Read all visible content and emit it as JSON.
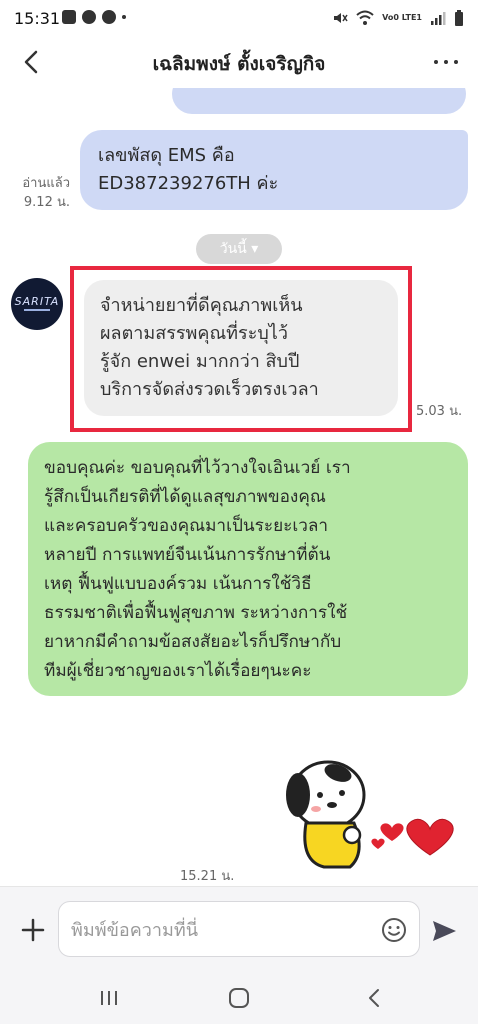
{
  "status_bar": {
    "time": "15:31",
    "network_label": "Vo0 LTE1",
    "icons": [
      "gallery-icon",
      "line-notification-icon",
      "line-notification-icon",
      "dot-icon",
      "mute-icon",
      "wifi-icon",
      "signal-icon",
      "battery-icon"
    ]
  },
  "header": {
    "title": "เฉลิมพงษ์ ตั้งเจริญกิจ",
    "back_icon": "back-arrow-icon",
    "more_icon": "more-icon"
  },
  "chat": {
    "messages": [
      {
        "direction": "outgoing",
        "text": "เลขพัสดุ EMS  คือ\nED387239276TH ค่ะ",
        "read_status": "อ่านแล้ว",
        "time": "9.12 น."
      },
      {
        "type": "date_separator",
        "label": "วันนี้ ▾"
      },
      {
        "direction": "incoming",
        "avatar_text": "SARITA",
        "text": "จำหน่ายยาที่ดีคุณภาพเห็น\nผลตามสรรพคุณที่ระบุไว้\nรู้จัก enwei มากกว่า สิบปี\nบริการจัดส่งรวดเร็วตรงเวลา",
        "time": "5.03 น.",
        "highlighted": true
      },
      {
        "direction": "outgoing",
        "style": "green",
        "text": "ขอบคุณค่ะ ขอบคุณที่ไว้วางใจเอินเวย์ เรา\nรู้สึกเป็นเกียรติที่ได้ดูแลสุขภาพของคุณ\nและครอบครัวของคุณมาเป็นระยะเวลา\nหลายปี การแพทย์จีนเน้นการรักษาที่ต้น\nเหตุ ฟื้นฟูแบบองค์รวม เน้นการใช้วิธี\nธรรมชาติเพื่อฟื้นฟูสุขภาพ ระหว่างการใช้\nยาหากมีคำถามข้อสงสัยอะไรก็ปรึกษากับ\nทีมผู้เชี่ยวชาญของเราได้เรื่อยๆนะคะ"
      },
      {
        "direction": "outgoing",
        "type": "sticker",
        "sticker": "puppy-with-hearts",
        "time": "15.21 น."
      }
    ]
  },
  "input_bar": {
    "plus_icon": "plus-icon",
    "placeholder": "พิมพ์ข้อความที่นี่",
    "emoji_icon": "emoji-icon",
    "send_icon": "send-icon"
  },
  "nav_bar": {
    "items": [
      "recent-apps-icon",
      "home-icon",
      "back-icon"
    ]
  },
  "colors": {
    "outgoing_bubble": "#cfd9f5",
    "green_bubble": "#b6e7a5",
    "incoming_bubble": "#eeeeee",
    "highlight_border": "#e8283f"
  }
}
